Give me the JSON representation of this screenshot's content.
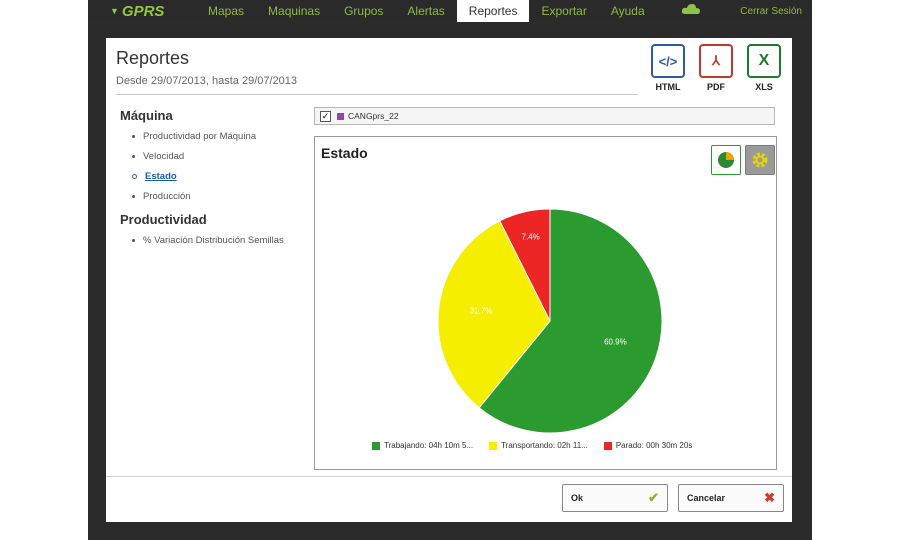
{
  "nav": {
    "logo": "GPRS",
    "items": [
      "Mapas",
      "Maquinas",
      "Grupos",
      "Alertas",
      "Reportes",
      "Exportar",
      "Ayuda"
    ],
    "active": "Reportes",
    "logout": "Cerrar Sesión"
  },
  "page": {
    "title": "Reportes",
    "subtitle": "Desde 29/07/2013, hasta 29/07/2013"
  },
  "exports": [
    {
      "label": "HTML",
      "icon": "code-icon",
      "glyph": "</>",
      "color": "#2a5aa8"
    },
    {
      "label": "PDF",
      "icon": "pdf-icon",
      "glyph": "⅄",
      "color": "#c0392b"
    },
    {
      "label": "XLS",
      "icon": "excel-icon",
      "glyph": "X",
      "color": "#1f7a2e"
    }
  ],
  "sidebar": {
    "section1": "Máquina",
    "section1_items": [
      "Productividad por Máquina",
      "Velocidad",
      "Estado",
      "Producción"
    ],
    "selected": "Estado",
    "section2": "Productividad",
    "section2_items": [
      "% Variación Distribución Semillas"
    ]
  },
  "series_filter": {
    "checked": true,
    "name": "CANGprs_22"
  },
  "chart_data": {
    "type": "pie",
    "title": "Estado",
    "slices": [
      {
        "label": "Trabajando: 04h 10m 5...",
        "value": 60.9,
        "color": "#2b9a2f",
        "data_label": "60.9%"
      },
      {
        "label": "Transportando: 02h 11...",
        "value": 31.7,
        "color": "#f5ee00",
        "data_label": "31.7%"
      },
      {
        "label": "Parado: 00h 30m 20s",
        "value": 7.4,
        "color": "#ec2525",
        "data_label": "7.4%"
      }
    ],
    "legend_position": "bottom"
  },
  "buttons": {
    "ok": "Ok",
    "cancel": "Cancelar"
  }
}
